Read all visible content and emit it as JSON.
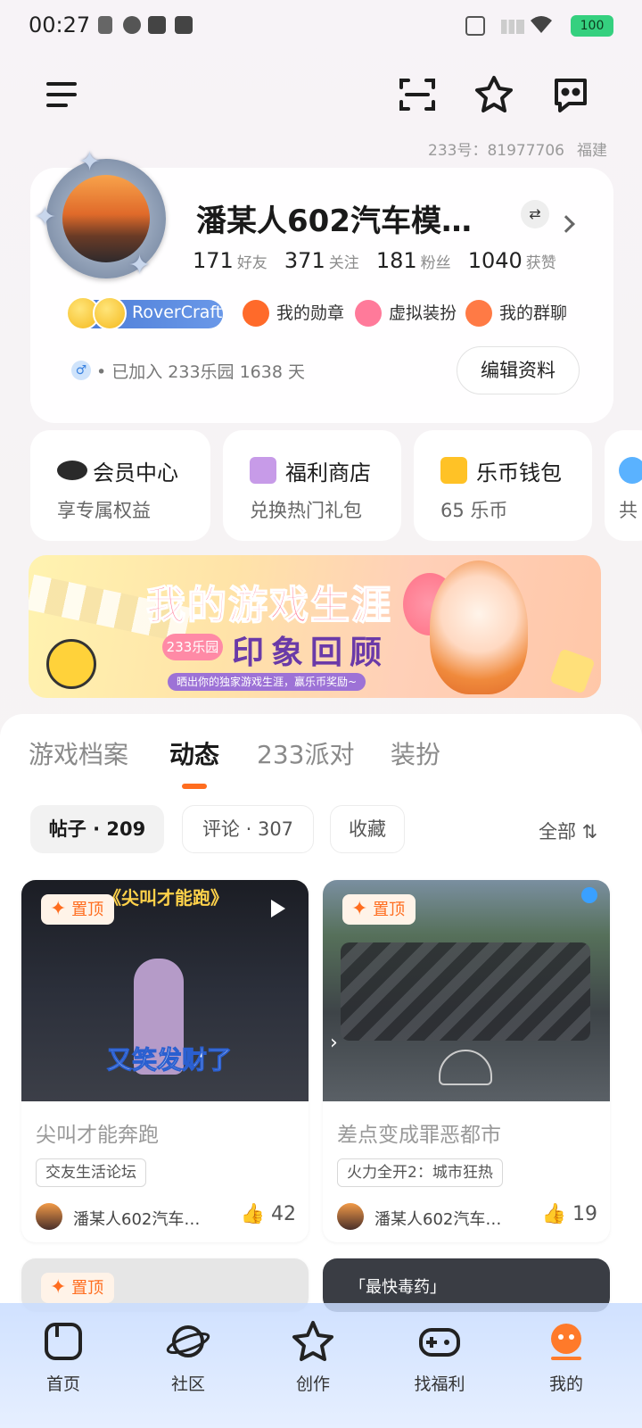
{
  "status": {
    "time": "00:27",
    "battery": "100"
  },
  "profile": {
    "id_label": "233号：81977706",
    "location": "福建",
    "name": "潘某人602汽车模…",
    "stats": [
      {
        "num": "171",
        "label": "好友"
      },
      {
        "num": "371",
        "label": "关注"
      },
      {
        "num": "181",
        "label": "粉丝"
      },
      {
        "num": "1040",
        "label": "获赞"
      }
    ],
    "craft_label": "RoverCraft",
    "features": [
      {
        "label": "我的勋章"
      },
      {
        "label": "虚拟装扮"
      },
      {
        "label": "我的群聊"
      }
    ],
    "gender": "♂",
    "joined": "• 已加入 233乐园 1638 天",
    "edit_label": "编辑资料"
  },
  "cards": [
    {
      "title": "会员中心",
      "sub": "享专属权益"
    },
    {
      "title": "福利商店",
      "sub": "兑换热门礼包"
    },
    {
      "title": "乐币钱包",
      "sub": "65 乐币"
    },
    {
      "title": "",
      "sub": "共"
    }
  ],
  "banner": {
    "title": "我的游戏生涯",
    "pill": "233乐园",
    "subtitle": "印象回顾",
    "note": "晒出你的独家游戏生涯，赢乐币奖励~"
  },
  "tabs": [
    {
      "label": "游戏档案"
    },
    {
      "label": "动态"
    },
    {
      "label": "233派对"
    },
    {
      "label": "装扮"
    }
  ],
  "chips": [
    {
      "label": "帖子 · 209"
    },
    {
      "label": "评论 · 307"
    },
    {
      "label": "收藏"
    }
  ],
  "sort_label": "全部 ⇅",
  "posts": [
    {
      "pin": "置顶",
      "overlay_top": "《尖叫才能跑》",
      "overlay_caption": "又笑发财了",
      "title": "尖叫才能奔跑",
      "tag": "交友生活论坛",
      "author": "潘某人602汽车…",
      "likes": "42"
    },
    {
      "pin": "置顶",
      "title": "差点变成罪恶都市",
      "tag": "火力全开2：城市狂热",
      "author": "潘某人602汽车…",
      "likes": "19"
    }
  ],
  "next_posts": [
    {
      "pin": "置顶"
    },
    {
      "overlay_top": "「最快毒药」"
    }
  ],
  "nav": [
    {
      "label": "首页"
    },
    {
      "label": "社区"
    },
    {
      "label": "创作"
    },
    {
      "label": "找福利"
    },
    {
      "label": "我的"
    }
  ]
}
